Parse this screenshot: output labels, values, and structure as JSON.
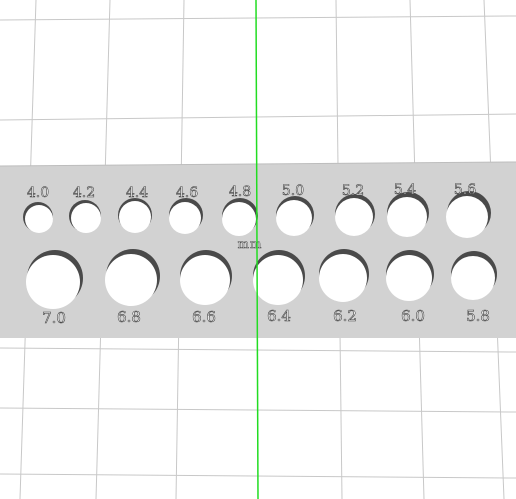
{
  "viewport": {
    "background_color": "#ffffff",
    "grid_color": "#c8c8c8",
    "axis_color": "#22dd22"
  },
  "model": {
    "plate_color": "#d2d2d2",
    "hole_color": "#ffffff",
    "hole_shadow_color": "#4a4a4a",
    "unit_label": "mm",
    "top_row_labels": [
      "4.0",
      "4.2",
      "4.4",
      "4.6",
      "4.8",
      "5.0",
      "5.2",
      "5.4",
      "5.6"
    ],
    "bottom_row_labels": [
      "7.0",
      "6.8",
      "6.6",
      "6.4",
      "6.2",
      "6.0",
      "5.8"
    ]
  }
}
